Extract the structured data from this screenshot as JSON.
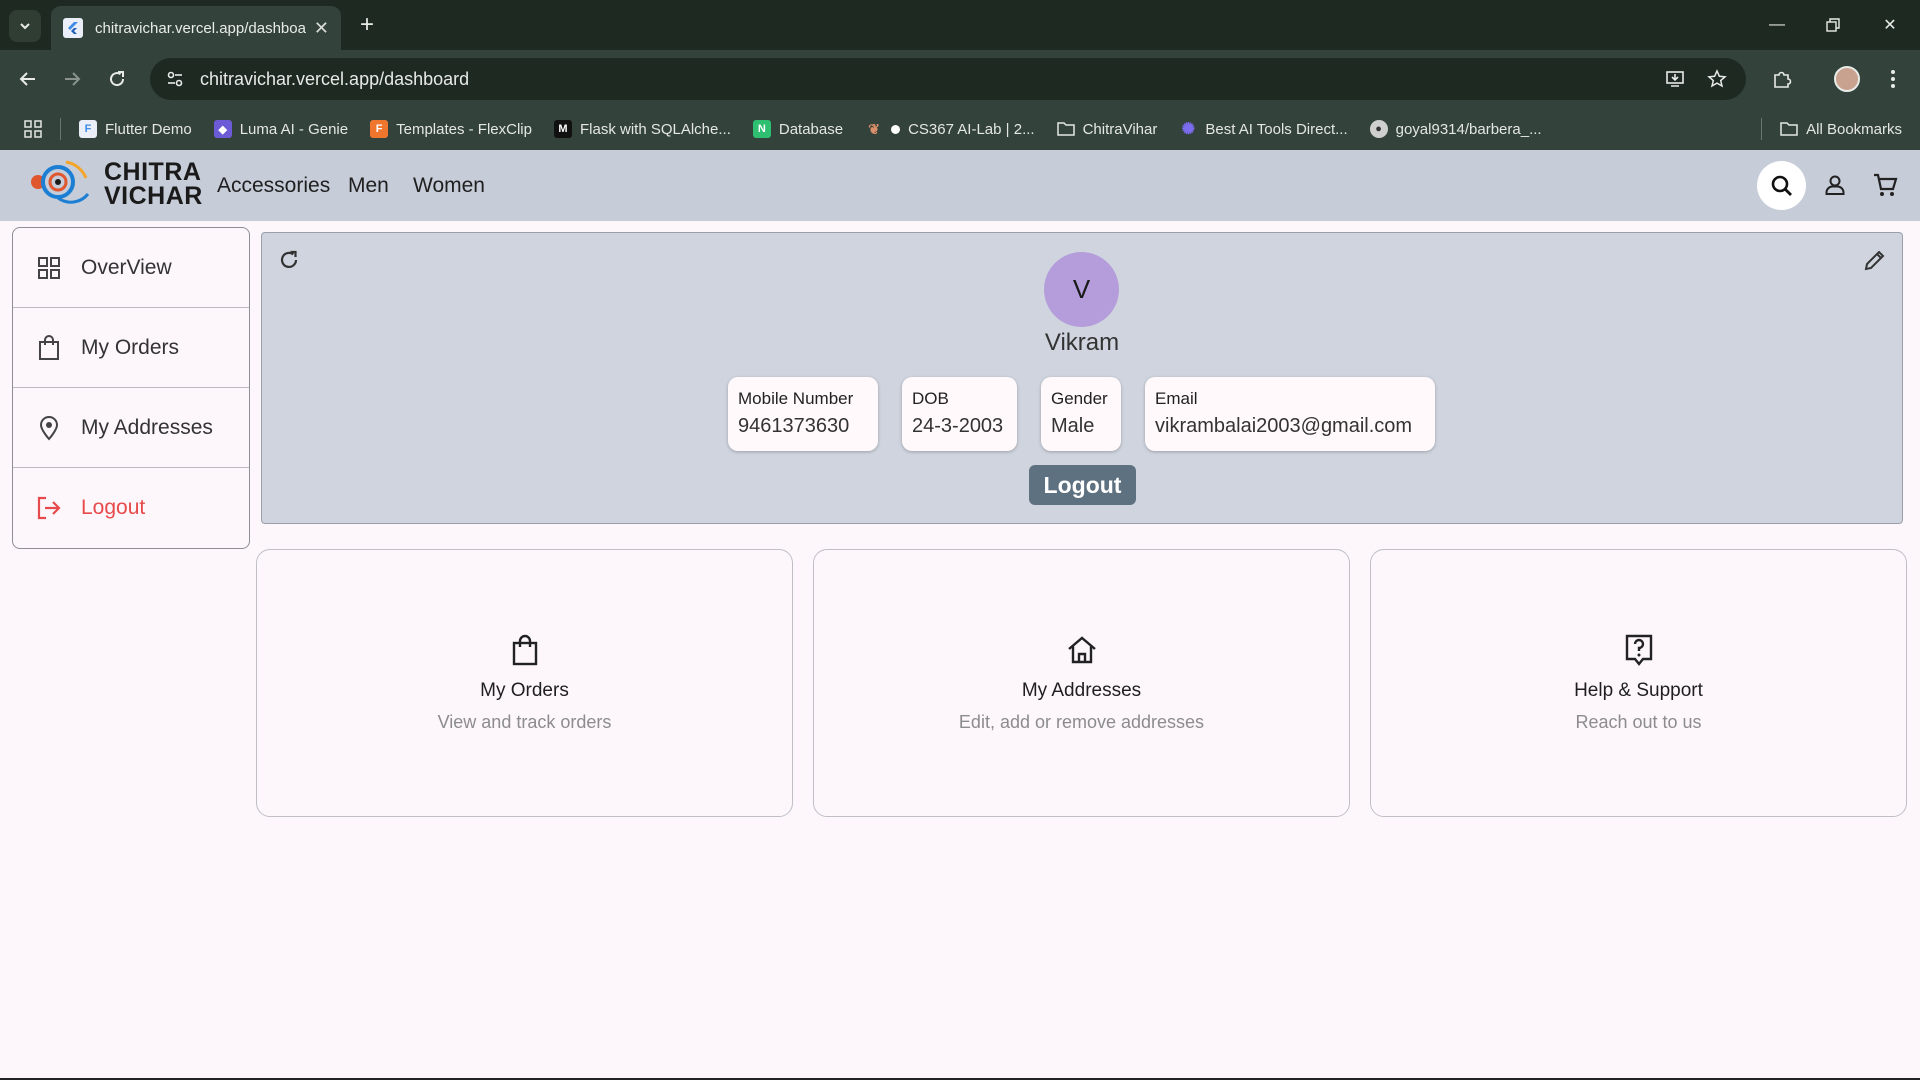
{
  "browser": {
    "tab_title": "chitravichar.vercel.app/dashboa",
    "url": "chitravichar.vercel.app/dashboard",
    "bookmarks": [
      {
        "label": "Flutter Demo",
        "color": "#4a90e2"
      },
      {
        "label": "Luma AI - Genie",
        "color": "#6b5bd6"
      },
      {
        "label": "Templates - FlexClip",
        "color": "#f0762d"
      },
      {
        "label": "Flask with SQLAlche...",
        "color": "#111111"
      },
      {
        "label": "Database",
        "color": "#2fbf71"
      },
      {
        "label": "CS367 AI-Lab | 2...",
        "color": "#ffffff"
      },
      {
        "label": "ChitraVihar",
        "color": "#e4e7e4"
      },
      {
        "label": "Best AI Tools Direct...",
        "color": "#7c6cf0"
      },
      {
        "label": "goyal9314/barbera_...",
        "color": "#cfcfcf"
      }
    ],
    "all_bookmarks": "All Bookmarks"
  },
  "header": {
    "logo_line1": "CHITRA",
    "logo_line2": "VICHAR",
    "nav": [
      "Accessories",
      "Men",
      "Women"
    ]
  },
  "sidebar": {
    "items": [
      {
        "label": "OverView",
        "icon": "grid-icon"
      },
      {
        "label": "My Orders",
        "icon": "bag-icon"
      },
      {
        "label": "My Addresses",
        "icon": "location-pin-icon"
      },
      {
        "label": "Logout",
        "icon": "logout-icon"
      }
    ]
  },
  "profile": {
    "avatar_initial": "V",
    "name": "Vikram",
    "fields": [
      {
        "label": "Mobile Number",
        "value": "9461373630"
      },
      {
        "label": "DOB",
        "value": "24-3-2003"
      },
      {
        "label": "Gender",
        "value": "Male"
      },
      {
        "label": "Email",
        "value": "vikrambalai2003@gmail.com"
      }
    ],
    "logout_label": "Logout"
  },
  "cards": [
    {
      "title": "My Orders",
      "subtitle": "View and track orders",
      "icon": "bag-icon"
    },
    {
      "title": "My Addresses",
      "subtitle": "Edit, add or remove addresses",
      "icon": "home-icon"
    },
    {
      "title": "Help & Support",
      "subtitle": "Reach out to us",
      "icon": "help-icon"
    }
  ],
  "colors": {
    "header_bg": "#c6ccd8",
    "profile_bg": "#cfd4de",
    "avatar_bg": "#b59ddb",
    "logout_btn": "#5e7181",
    "logout_text": "#e64a4a"
  }
}
